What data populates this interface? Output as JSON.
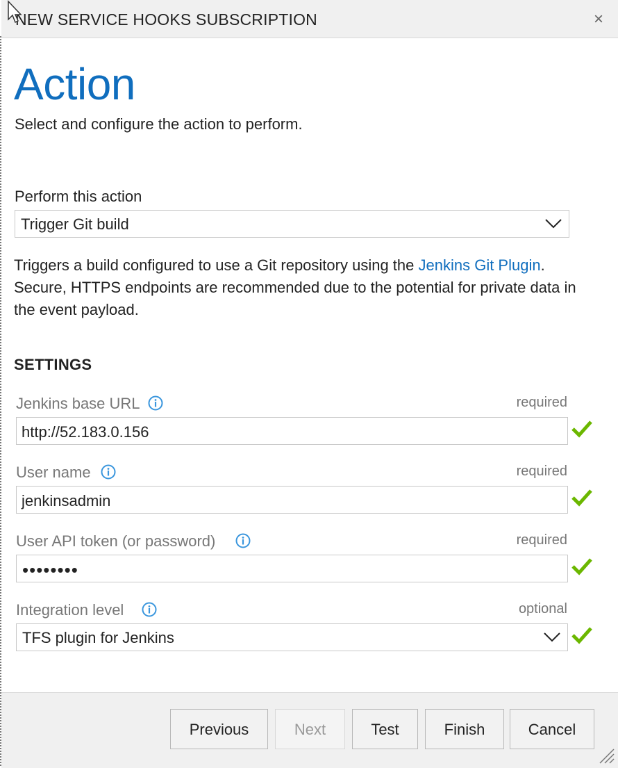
{
  "dialog": {
    "title": "NEW SERVICE HOOKS SUBSCRIPTION",
    "close_label": "×"
  },
  "page": {
    "heading": "Action",
    "subtitle": "Select and configure the action to perform."
  },
  "action": {
    "label": "Perform this action",
    "selected": "Trigger Git build"
  },
  "description": {
    "text_before": "Triggers a build configured to use a Git repository using the ",
    "link_text": "Jenkins Git Plugin",
    "text_after": ". Secure, HTTPS endpoints are recommended due to the potential for private data in the event payload."
  },
  "settings": {
    "heading": "SETTINGS",
    "fields": [
      {
        "label": "Jenkins base URL",
        "requirement": "required",
        "value": "http://52.183.0.156"
      },
      {
        "label": "User name",
        "requirement": "required",
        "value": "jenkinsadmin"
      },
      {
        "label": "User API token (or password)",
        "requirement": "required",
        "value": "••••••••"
      },
      {
        "label": "Integration level",
        "requirement": "optional",
        "value": "TFS plugin for Jenkins"
      }
    ]
  },
  "buttons": {
    "previous": "Previous",
    "next": "Next",
    "test": "Test",
    "finish": "Finish",
    "cancel": "Cancel"
  },
  "colors": {
    "accent": "#106ebe",
    "valid": "#6bb700",
    "info": "#3a96dd"
  }
}
